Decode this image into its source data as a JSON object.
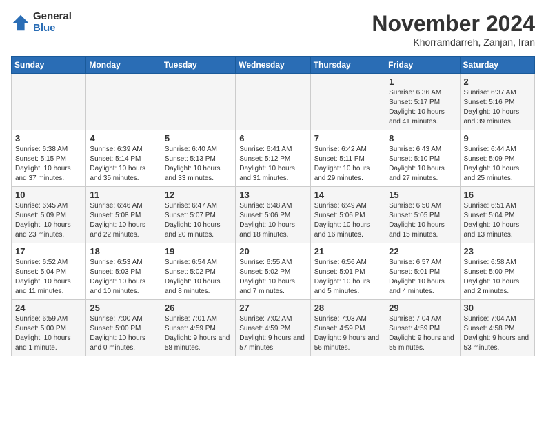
{
  "logo": {
    "general": "General",
    "blue": "Blue"
  },
  "title": "November 2024",
  "subtitle": "Khorramdarreh, Zanjan, Iran",
  "days_of_week": [
    "Sunday",
    "Monday",
    "Tuesday",
    "Wednesday",
    "Thursday",
    "Friday",
    "Saturday"
  ],
  "weeks": [
    [
      {
        "day": "",
        "info": ""
      },
      {
        "day": "",
        "info": ""
      },
      {
        "day": "",
        "info": ""
      },
      {
        "day": "",
        "info": ""
      },
      {
        "day": "",
        "info": ""
      },
      {
        "day": "1",
        "info": "Sunrise: 6:36 AM\nSunset: 5:17 PM\nDaylight: 10 hours and 41 minutes."
      },
      {
        "day": "2",
        "info": "Sunrise: 6:37 AM\nSunset: 5:16 PM\nDaylight: 10 hours and 39 minutes."
      }
    ],
    [
      {
        "day": "3",
        "info": "Sunrise: 6:38 AM\nSunset: 5:15 PM\nDaylight: 10 hours and 37 minutes."
      },
      {
        "day": "4",
        "info": "Sunrise: 6:39 AM\nSunset: 5:14 PM\nDaylight: 10 hours and 35 minutes."
      },
      {
        "day": "5",
        "info": "Sunrise: 6:40 AM\nSunset: 5:13 PM\nDaylight: 10 hours and 33 minutes."
      },
      {
        "day": "6",
        "info": "Sunrise: 6:41 AM\nSunset: 5:12 PM\nDaylight: 10 hours and 31 minutes."
      },
      {
        "day": "7",
        "info": "Sunrise: 6:42 AM\nSunset: 5:11 PM\nDaylight: 10 hours and 29 minutes."
      },
      {
        "day": "8",
        "info": "Sunrise: 6:43 AM\nSunset: 5:10 PM\nDaylight: 10 hours and 27 minutes."
      },
      {
        "day": "9",
        "info": "Sunrise: 6:44 AM\nSunset: 5:09 PM\nDaylight: 10 hours and 25 minutes."
      }
    ],
    [
      {
        "day": "10",
        "info": "Sunrise: 6:45 AM\nSunset: 5:09 PM\nDaylight: 10 hours and 23 minutes."
      },
      {
        "day": "11",
        "info": "Sunrise: 6:46 AM\nSunset: 5:08 PM\nDaylight: 10 hours and 22 minutes."
      },
      {
        "day": "12",
        "info": "Sunrise: 6:47 AM\nSunset: 5:07 PM\nDaylight: 10 hours and 20 minutes."
      },
      {
        "day": "13",
        "info": "Sunrise: 6:48 AM\nSunset: 5:06 PM\nDaylight: 10 hours and 18 minutes."
      },
      {
        "day": "14",
        "info": "Sunrise: 6:49 AM\nSunset: 5:06 PM\nDaylight: 10 hours and 16 minutes."
      },
      {
        "day": "15",
        "info": "Sunrise: 6:50 AM\nSunset: 5:05 PM\nDaylight: 10 hours and 15 minutes."
      },
      {
        "day": "16",
        "info": "Sunrise: 6:51 AM\nSunset: 5:04 PM\nDaylight: 10 hours and 13 minutes."
      }
    ],
    [
      {
        "day": "17",
        "info": "Sunrise: 6:52 AM\nSunset: 5:04 PM\nDaylight: 10 hours and 11 minutes."
      },
      {
        "day": "18",
        "info": "Sunrise: 6:53 AM\nSunset: 5:03 PM\nDaylight: 10 hours and 10 minutes."
      },
      {
        "day": "19",
        "info": "Sunrise: 6:54 AM\nSunset: 5:02 PM\nDaylight: 10 hours and 8 minutes."
      },
      {
        "day": "20",
        "info": "Sunrise: 6:55 AM\nSunset: 5:02 PM\nDaylight: 10 hours and 7 minutes."
      },
      {
        "day": "21",
        "info": "Sunrise: 6:56 AM\nSunset: 5:01 PM\nDaylight: 10 hours and 5 minutes."
      },
      {
        "day": "22",
        "info": "Sunrise: 6:57 AM\nSunset: 5:01 PM\nDaylight: 10 hours and 4 minutes."
      },
      {
        "day": "23",
        "info": "Sunrise: 6:58 AM\nSunset: 5:00 PM\nDaylight: 10 hours and 2 minutes."
      }
    ],
    [
      {
        "day": "24",
        "info": "Sunrise: 6:59 AM\nSunset: 5:00 PM\nDaylight: 10 hours and 1 minute."
      },
      {
        "day": "25",
        "info": "Sunrise: 7:00 AM\nSunset: 5:00 PM\nDaylight: 10 hours and 0 minutes."
      },
      {
        "day": "26",
        "info": "Sunrise: 7:01 AM\nSunset: 4:59 PM\nDaylight: 9 hours and 58 minutes."
      },
      {
        "day": "27",
        "info": "Sunrise: 7:02 AM\nSunset: 4:59 PM\nDaylight: 9 hours and 57 minutes."
      },
      {
        "day": "28",
        "info": "Sunrise: 7:03 AM\nSunset: 4:59 PM\nDaylight: 9 hours and 56 minutes."
      },
      {
        "day": "29",
        "info": "Sunrise: 7:04 AM\nSunset: 4:59 PM\nDaylight: 9 hours and 55 minutes."
      },
      {
        "day": "30",
        "info": "Sunrise: 7:04 AM\nSunset: 4:58 PM\nDaylight: 9 hours and 53 minutes."
      }
    ]
  ]
}
